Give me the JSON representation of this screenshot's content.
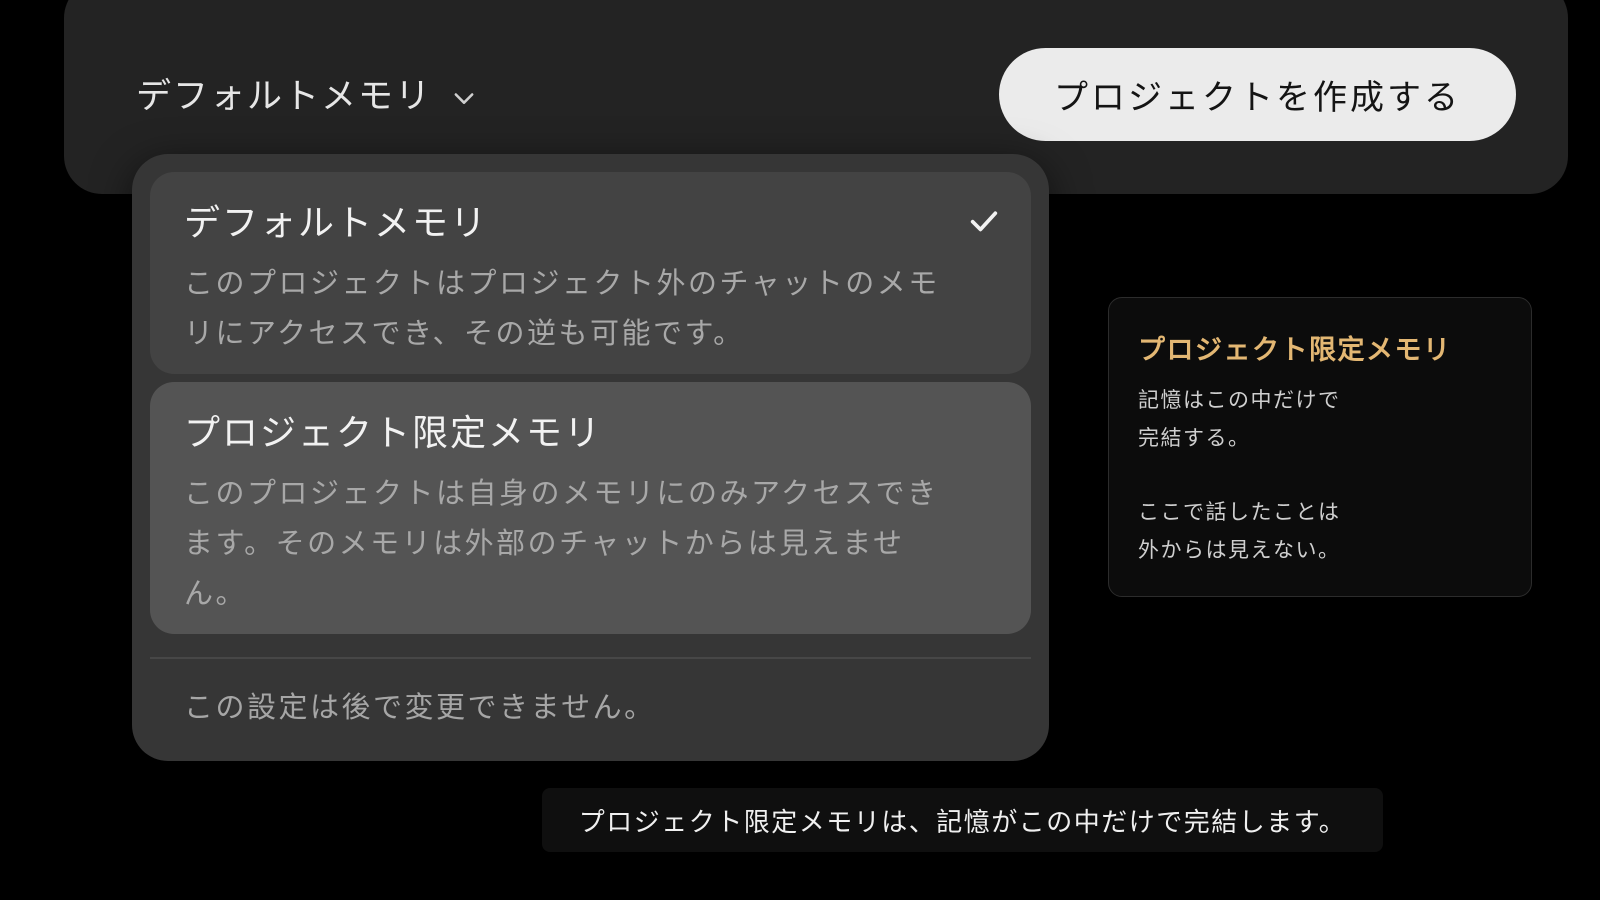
{
  "header": {
    "memory_selector_label": "デフォルトメモリ",
    "create_project_label": "プロジェクトを作成する"
  },
  "dropdown": {
    "options": [
      {
        "title": "デフォルトメモリ",
        "description": "このプロジェクトはプロジェクト外のチャットのメモリにアクセスでき、その逆も可能です。",
        "selected": true
      },
      {
        "title": "プロジェクト限定メモリ",
        "description": "このプロジェクトは自身のメモリにのみアクセスできます。そのメモリは外部のチャットからは見えません。",
        "selected": false
      }
    ],
    "footnote": "この設定は後で変更できません。"
  },
  "info_card": {
    "title": "プロジェクト限定メモリ",
    "lines_1": [
      "記憶はこの中だけで",
      "完結する。"
    ],
    "lines_2": [
      "ここで話したことは",
      "外からは見えない。"
    ]
  },
  "caption": "プロジェクト限定メモリは、記憶がこの中だけで完結します。",
  "colors": {
    "background": "#000000",
    "panel": "#232323",
    "menu": "#363636",
    "accent_gold": "#e3b773",
    "button_bg": "#ebebeb"
  },
  "icons": {
    "selector_chevron": "chevron-down-icon",
    "selected_mark": "checkmark-icon"
  }
}
